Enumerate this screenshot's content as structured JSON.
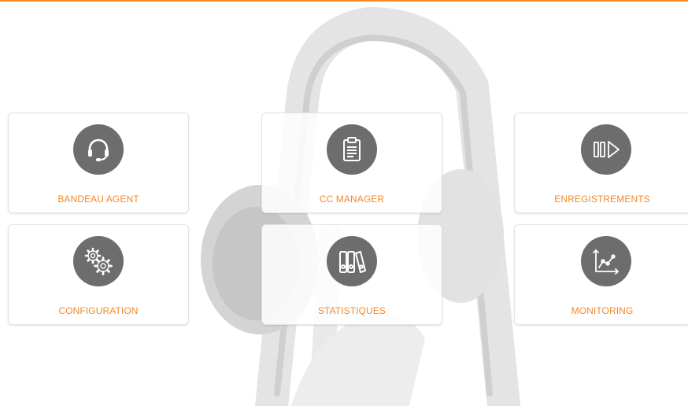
{
  "colors": {
    "accent": "#f08a2c",
    "icon_bg": "#6d6d6d"
  },
  "tiles": [
    {
      "label": "BANDEAU AGENT",
      "icon": "headset-icon"
    },
    {
      "label": "CC MANAGER",
      "icon": "clipboard-icon"
    },
    {
      "label": "ENREGISTREMENTS",
      "icon": "pause-play-icon"
    },
    {
      "label": "CONFIGURATION",
      "icon": "gears-icon"
    },
    {
      "label": "STATISTIQUES",
      "icon": "binders-icon"
    },
    {
      "label": "MONITORING",
      "icon": "line-chart-icon"
    }
  ]
}
